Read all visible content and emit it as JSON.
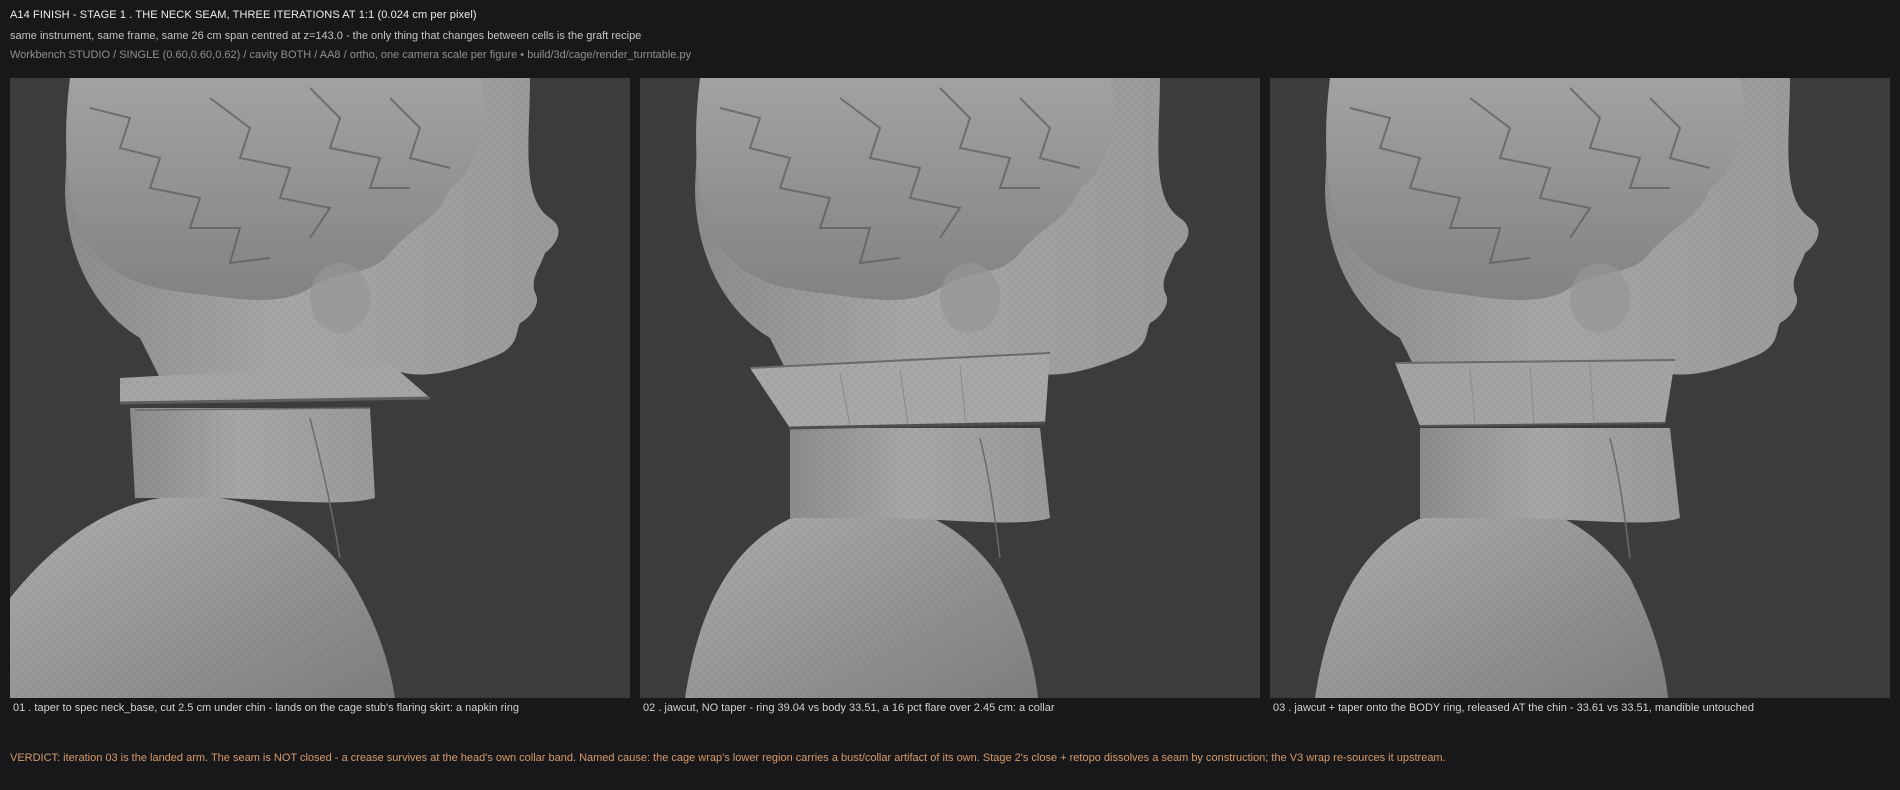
{
  "header": {
    "title": "A14 FINISH - STAGE 1 . THE NECK SEAM, THREE ITERATIONS AT 1:1 (0.024 cm per pixel)",
    "subtitle": "same instrument, same frame, same 26 cm span centred at z=143.0 - the only thing that changes between cells is the graft recipe",
    "meta": "Workbench STUDIO / SINGLE (0.60,0.60,0.62) / cavity BOTH / AA8 / ortho, one camera scale per figure • build/3d/cage/render_turntable.py"
  },
  "panels": [
    {
      "caption": "01 . taper to spec neck_base, cut 2.5 cm under chin - lands on the cage stub's flaring skirt: a napkin ring"
    },
    {
      "caption": "02 . jawcut, NO taper - ring 39.04 vs body 33.51, a 16 pct flare over 2.45 cm: a collar"
    },
    {
      "caption": "03 . jawcut + taper onto the BODY ring, released AT the chin - 33.61 vs 33.51, mandible untouched"
    }
  ],
  "verdict": "VERDICT: iteration 03 is the landed arm. The seam is NOT closed - a crease survives at the head's own collar band. Named cause: the cage wrap's lower region carries a bust/collar artifact of its own. Stage 2's close + retopo dissolves a seam by construction; the V3 wrap re-sources it upstream.",
  "colors": {
    "background": "#18181a",
    "viewport": "#3c3c3c",
    "mesh": "#9a9a9a",
    "verdict": "#d59a6c"
  }
}
